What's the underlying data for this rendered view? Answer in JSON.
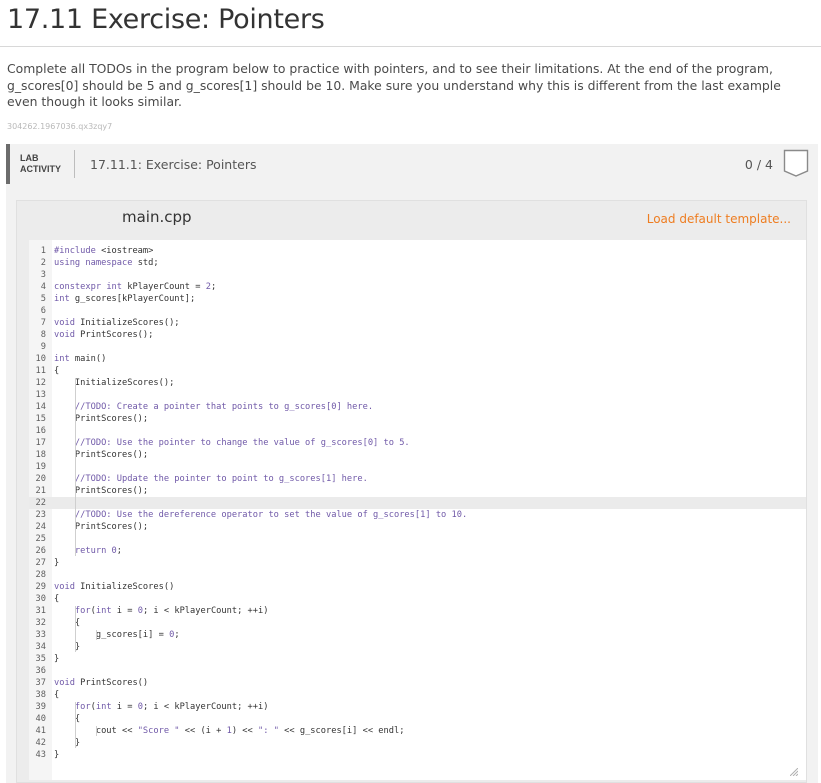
{
  "page": {
    "title": "17.11 Exercise: Pointers",
    "description": "Complete all TODOs in the program below to practice with pointers, and to see their limitations. At the end of the program, g_scores[0] should be 5 and g_scores[1] should be 10. Make sure you understand why this is different from the last example even though it looks similar.",
    "ref_id": "304262.1967036.qx3zqy7"
  },
  "lab": {
    "tag_line1": "LAB",
    "tag_line2": "ACTIVITY",
    "name": "17.11.1: Exercise: Pointers",
    "score": "0 / 4"
  },
  "editor": {
    "filename": "main.cpp",
    "load_template": "Load default template...",
    "lines": [
      "#include <iostream>",
      "using namespace std;",
      "",
      "constexpr int kPlayerCount = 2;",
      "int g_scores[kPlayerCount];",
      "",
      "void InitializeScores();",
      "void PrintScores();",
      "",
      "int main()",
      "{",
      "    InitializeScores();",
      "",
      "    //TODO: Create a pointer that points to g_scores[0] here.",
      "    PrintScores();",
      "",
      "    //TODO: Use the pointer to change the value of g_scores[0] to 5.",
      "    PrintScores();",
      "",
      "    //TODO: Update the pointer to point to g_scores[1] here.",
      "    PrintScores();",
      "",
      "    //TODO: Use the dereference operator to set the value of g_scores[1] to 10.",
      "    PrintScores();",
      "",
      "    return 0;",
      "}",
      "",
      "void InitializeScores()",
      "{",
      "    for(int i = 0; i < kPlayerCount; ++i)",
      "    {",
      "        g_scores[i] = 0;",
      "    }",
      "}",
      "",
      "void PrintScores()",
      "{",
      "    for(int i = 0; i < kPlayerCount; ++i)",
      "    {",
      "        cout << \"Score \" << (i + 1) << \": \" << g_scores[i] << endl;",
      "    }",
      "}"
    ],
    "active_line": 22
  }
}
